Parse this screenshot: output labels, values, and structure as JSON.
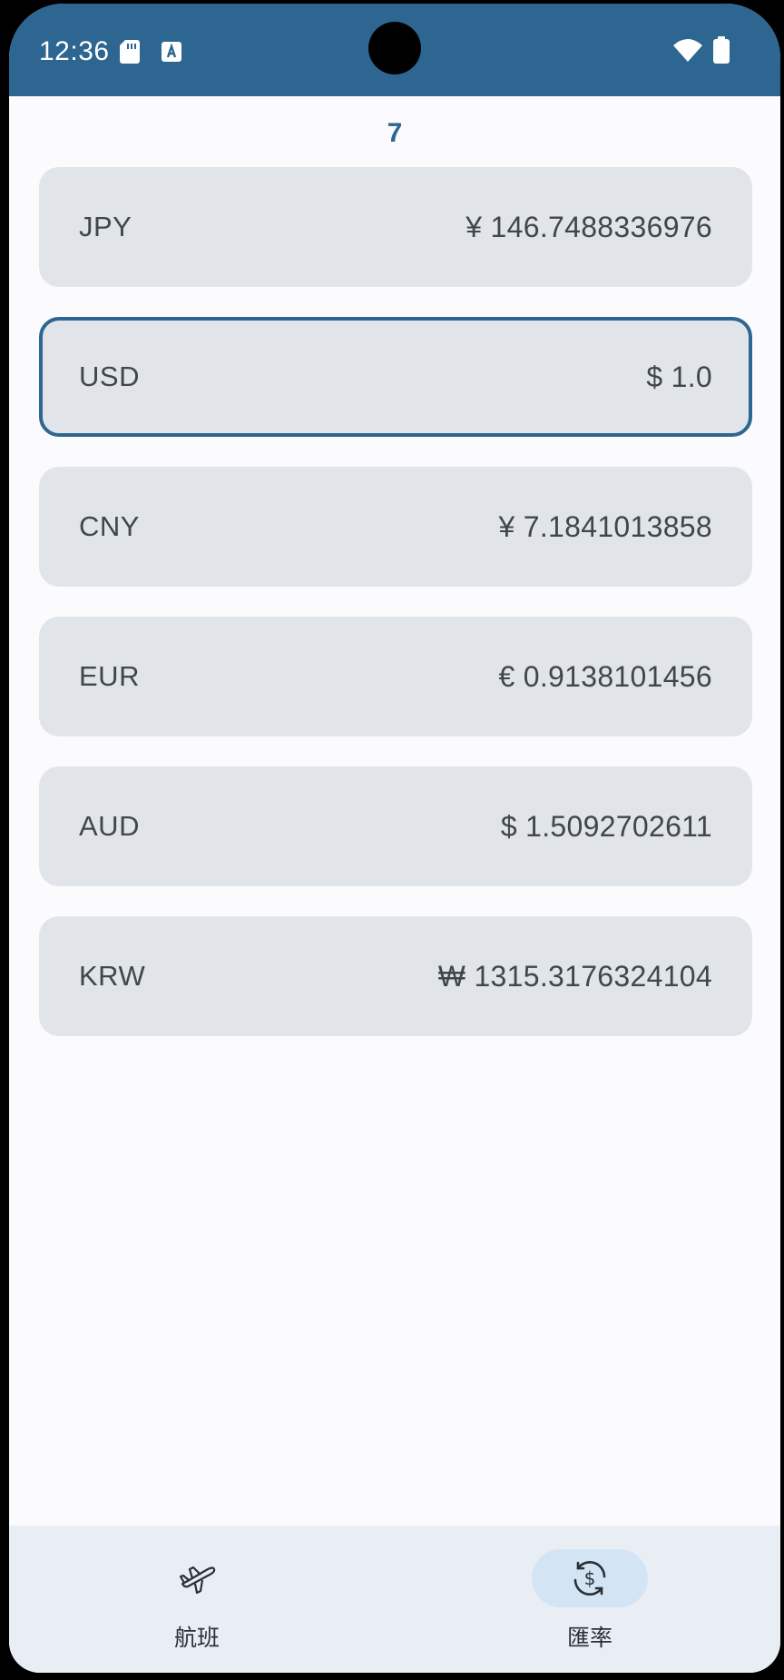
{
  "status_bar": {
    "time": "12:36",
    "icons": [
      "sd-card-icon",
      "a-notification-icon",
      "wifi-icon",
      "battery-icon"
    ],
    "background_color": "#2c6691"
  },
  "page_counter": "7",
  "rates": [
    {
      "code": "JPY",
      "value": "¥ 146.7488336976",
      "selected": false
    },
    {
      "code": "USD",
      "value": "$ 1.0",
      "selected": true
    },
    {
      "code": "CNY",
      "value": "¥ 7.1841013858",
      "selected": false
    },
    {
      "code": "EUR",
      "value": "€ 0.9138101456",
      "selected": false
    },
    {
      "code": "AUD",
      "value": "$ 1.5092702611",
      "selected": false
    },
    {
      "code": "KRW",
      "value": "₩ 1315.3176324104",
      "selected": false
    }
  ],
  "bottom_nav": {
    "items": [
      {
        "label": "航班",
        "icon": "airplane-icon",
        "active": false
      },
      {
        "label": "匯率",
        "icon": "currency-exchange-icon",
        "active": true
      }
    ]
  },
  "colors": {
    "accent": "#2c6691",
    "card_background": "#e1e5ea",
    "page_background": "#fbfbfe",
    "nav_background": "#e9eef5",
    "active_pill": "#d3e4f4"
  }
}
